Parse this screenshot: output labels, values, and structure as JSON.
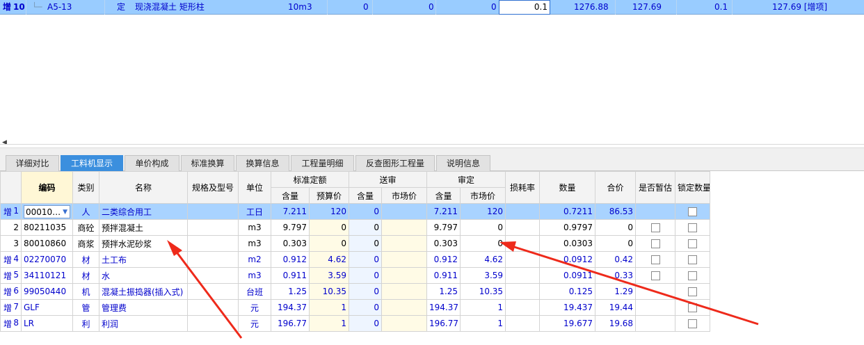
{
  "top_row": {
    "add_label": "增",
    "row_no": "10",
    "code": "A5-13",
    "type": "定",
    "name": "现浇混凝土 矩形柱",
    "unit": "10m3",
    "v1": "0",
    "v2": "0",
    "v3": "0",
    "input_value": "0.1",
    "v4": "1276.88",
    "v5": "127.69",
    "v6": "0.1",
    "v7": "127.69 [增项]"
  },
  "tabs": [
    "详细对比",
    "工料机显示",
    "单价构成",
    "标准换算",
    "换算信息",
    "工程量明细",
    "反查图形工程量",
    "说明信息"
  ],
  "active_tab": 1,
  "headers": {
    "code": "编码",
    "category": "类别",
    "name": "名称",
    "spec": "规格及型号",
    "unit": "单位",
    "standard": "标准定额",
    "submit": "送审",
    "approve": "审定",
    "loss": "损耗率",
    "qty": "数量",
    "total": "合价",
    "temp": "是否暂估",
    "lock": "锁定数量",
    "content": "含量",
    "budget_price": "预算价",
    "market_price": "市场价"
  },
  "rows": [
    {
      "add": "增",
      "no": "1",
      "code": "00010…",
      "cat": "人",
      "name": "二类综合用工",
      "unit": "工日",
      "std_qty": "7.211",
      "std_price": "120",
      "sub_qty": "0",
      "sub_price": "",
      "apr_qty": "7.211",
      "apr_price": "120",
      "qty": "0.7211",
      "total": "86.53",
      "temp": false,
      "lock": true
    },
    {
      "add": "",
      "no": "2",
      "code": "80211035",
      "cat": "商砼",
      "name": "预拌混凝土",
      "unit": "m3",
      "std_qty": "9.797",
      "std_price": "0",
      "sub_qty": "0",
      "sub_price": "",
      "apr_qty": "9.797",
      "apr_price": "0",
      "qty": "0.9797",
      "total": "0",
      "temp": true,
      "lock": true
    },
    {
      "add": "",
      "no": "3",
      "code": "80010860",
      "cat": "商浆",
      "name": "预拌水泥砂浆",
      "unit": "m3",
      "std_qty": "0.303",
      "std_price": "0",
      "sub_qty": "0",
      "sub_price": "",
      "apr_qty": "0.303",
      "apr_price": "0",
      "qty": "0.0303",
      "total": "0",
      "temp": true,
      "lock": true
    },
    {
      "add": "增",
      "no": "4",
      "code": "02270070",
      "cat": "材",
      "name": "土工布",
      "unit": "m2",
      "std_qty": "0.912",
      "std_price": "4.62",
      "sub_qty": "0",
      "sub_price": "",
      "apr_qty": "0.912",
      "apr_price": "4.62",
      "qty": "0.0912",
      "total": "0.42",
      "temp": true,
      "lock": true
    },
    {
      "add": "增",
      "no": "5",
      "code": "34110121",
      "cat": "材",
      "name": "水",
      "unit": "m3",
      "std_qty": "0.911",
      "std_price": "3.59",
      "sub_qty": "0",
      "sub_price": "",
      "apr_qty": "0.911",
      "apr_price": "3.59",
      "qty": "0.0911",
      "total": "0.33",
      "temp": true,
      "lock": true
    },
    {
      "add": "增",
      "no": "6",
      "code": "99050440",
      "cat": "机",
      "name": "混凝土振捣器(插入式)",
      "unit": "台班",
      "std_qty": "1.25",
      "std_price": "10.35",
      "sub_qty": "0",
      "sub_price": "",
      "apr_qty": "1.25",
      "apr_price": "10.35",
      "qty": "0.125",
      "total": "1.29",
      "temp": false,
      "lock": true
    },
    {
      "add": "增",
      "no": "7",
      "code": "GLF",
      "cat": "管",
      "name": "管理费",
      "unit": "元",
      "std_qty": "194.37",
      "std_price": "1",
      "sub_qty": "0",
      "sub_price": "",
      "apr_qty": "194.37",
      "apr_price": "1",
      "qty": "19.437",
      "total": "19.44",
      "temp": false,
      "lock": true
    },
    {
      "add": "增",
      "no": "8",
      "code": "LR",
      "cat": "利",
      "name": "利润",
      "unit": "元",
      "std_qty": "196.77",
      "std_price": "1",
      "sub_qty": "0",
      "sub_price": "",
      "apr_qty": "196.77",
      "apr_price": "1",
      "qty": "19.677",
      "total": "19.68",
      "temp": false,
      "lock": true
    }
  ],
  "colors": {
    "selected_row": "#a9d3ff",
    "active_tab": "#3b8fde",
    "annotation_arrow": "#ee2a1b"
  }
}
